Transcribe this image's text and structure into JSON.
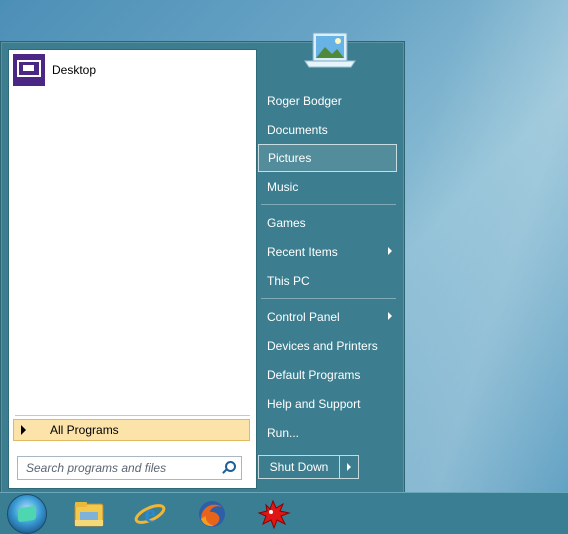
{
  "start_menu": {
    "pinned": [
      {
        "label": "Desktop",
        "icon": "desktop-icon"
      }
    ],
    "all_programs_label": "All Programs",
    "search_placeholder": "Search programs and files",
    "right_items": [
      {
        "label": "Roger Bodger"
      },
      {
        "label": "Documents"
      },
      {
        "label": "Pictures",
        "highlighted": true
      },
      {
        "label": "Music"
      },
      {
        "label": "Games"
      },
      {
        "label": "Recent Items",
        "submenu": true
      },
      {
        "label": "This PC"
      },
      {
        "label": "Control Panel",
        "submenu": true
      },
      {
        "label": "Devices and Printers"
      },
      {
        "label": "Default Programs"
      },
      {
        "label": "Help and Support"
      },
      {
        "label": "Run..."
      }
    ],
    "shutdown_label": "Shut Down"
  },
  "taskbar": {
    "items": [
      {
        "icon": "start-orb-icon"
      },
      {
        "icon": "file-explorer-icon"
      },
      {
        "icon": "internet-explorer-icon"
      },
      {
        "icon": "firefox-icon"
      },
      {
        "icon": "red-splat-app-icon"
      }
    ]
  },
  "colors": {
    "menu_background": "#3c7e8f",
    "all_programs_highlight": "#fbe3a9",
    "taskbar": "#3a7e94"
  }
}
